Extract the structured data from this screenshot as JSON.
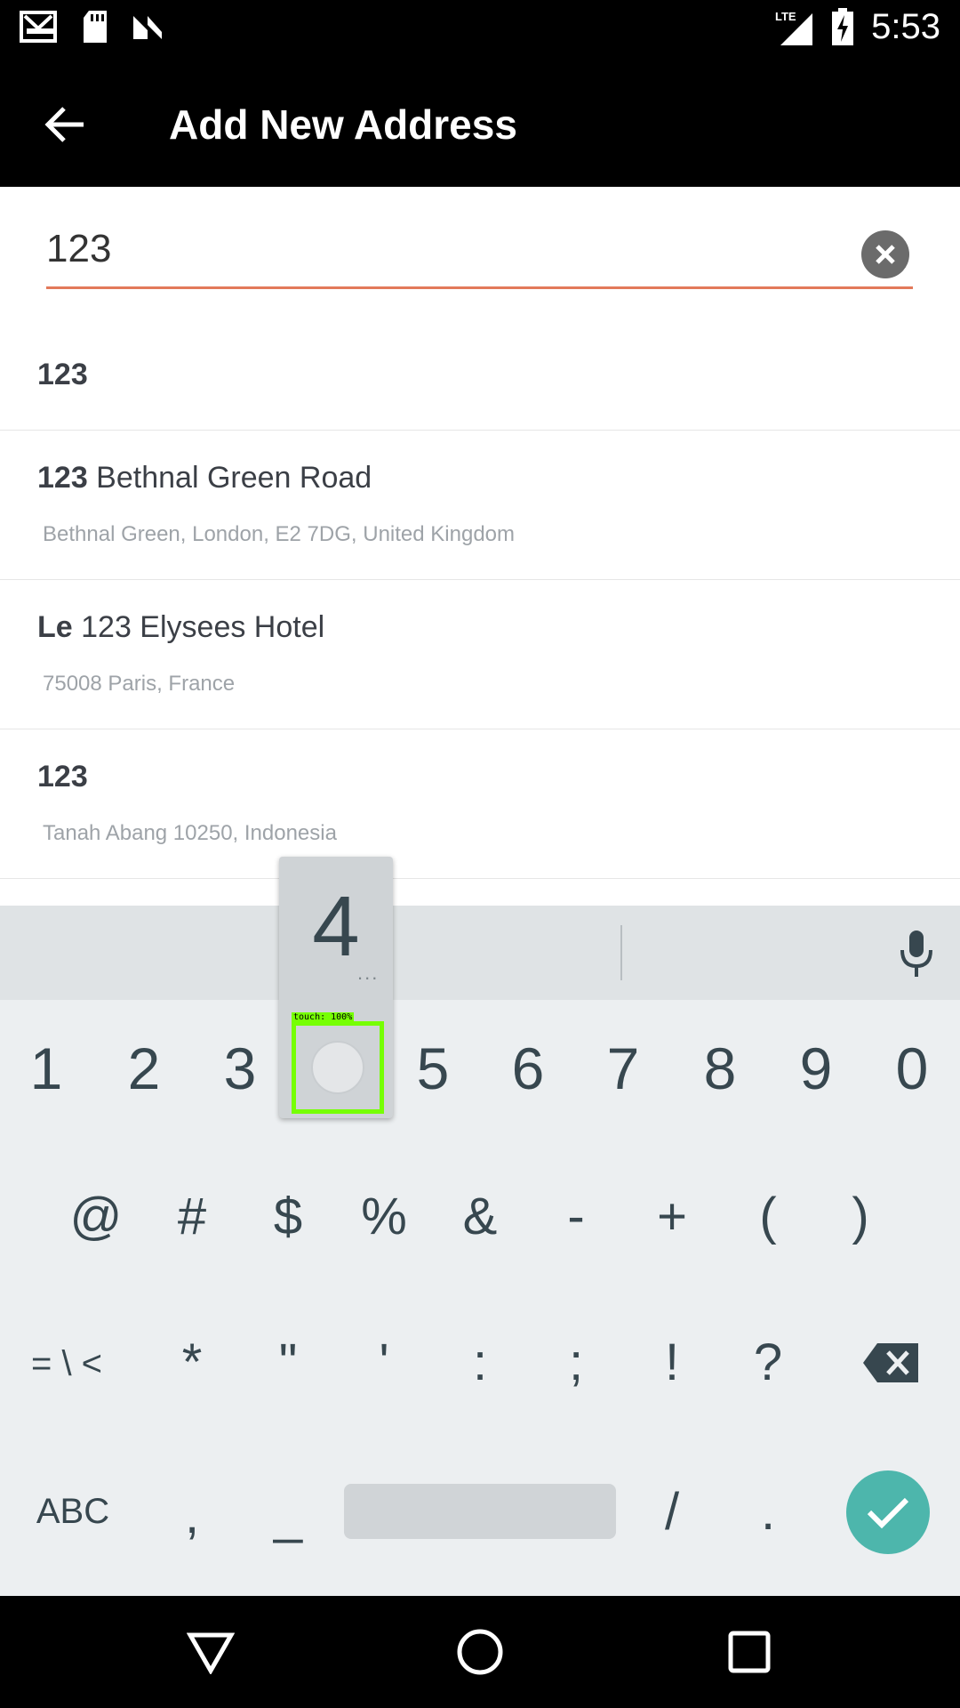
{
  "status_bar": {
    "time": "5:53",
    "network": "LTE",
    "icons": [
      "gmail-icon",
      "sd-card-icon",
      "n-icon",
      "signal-icon",
      "battery-charging-icon"
    ]
  },
  "app_bar": {
    "title": "Add New Address",
    "back_icon": "arrow-back-icon"
  },
  "search": {
    "value": "123",
    "clear_icon": "clear-icon",
    "underline_color": "#e3795a"
  },
  "results": [
    {
      "bold": "123",
      "rest": "",
      "subtitle": ""
    },
    {
      "bold": "123",
      "rest": " Bethnal Green Road",
      "subtitle": "Bethnal Green, London, E2 7DG, United Kingdom"
    },
    {
      "bold": "Le",
      "rest": " 123 Elysees Hotel",
      "subtitle": "75008 Paris, France"
    },
    {
      "bold": "123",
      "rest": "",
      "subtitle": "Tanah Abang 10250, Indonesia"
    }
  ],
  "keyboard": {
    "row1": [
      "1",
      "2",
      "3",
      "4",
      "5",
      "6",
      "7",
      "8",
      "9",
      "0"
    ],
    "row2": [
      "@",
      "#",
      "$",
      "%",
      "&",
      "-",
      "+",
      "(",
      ")"
    ],
    "row3": [
      "= \\ <",
      "*",
      "\"",
      "'",
      ":",
      ";",
      "!",
      "?"
    ],
    "row4": [
      "ABC",
      ",",
      "_",
      "/",
      "."
    ],
    "mic_icon": "mic-icon",
    "backspace_icon": "backspace-icon",
    "enter_icon": "check-icon",
    "enter_color": "#4db6ac"
  },
  "key_popup": {
    "char": "4",
    "more": "...",
    "touch_label": "touch: 100%"
  },
  "nav_bar": {
    "icons": [
      "back-triangle-icon",
      "home-circle-icon",
      "recents-square-icon"
    ]
  }
}
